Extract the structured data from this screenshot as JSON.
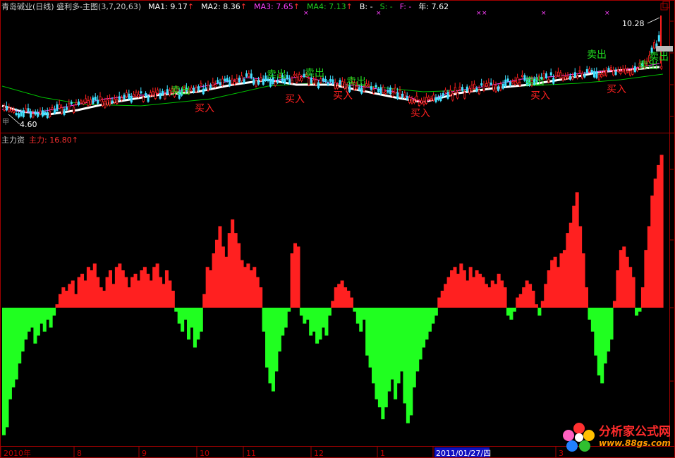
{
  "header": {
    "title": "青岛碱业(日线) 盛利多-主图(3,7,20,63)",
    "ma1": "MA1: 9.17",
    "ma2": "MA2: 8.36",
    "ma3": "MA3: 7.65",
    "ma4": "MA4: 7.13",
    "b": "B: -",
    "s": "S: -",
    "f": "F: -",
    "year": "年: 7.62",
    "arrow": "↑"
  },
  "sub_header": {
    "title": "主力资",
    "main_force": "主力: 16.80",
    "arrow": "↑"
  },
  "price_panel": {
    "high_label": "10.28",
    "low_label": "4.60",
    "bottom_left_label": "甲 ",
    "signals": [
      {
        "type": "sell",
        "label": "卖出"
      },
      {
        "type": "sell",
        "label": "卖出"
      },
      {
        "type": "sell",
        "label": "卖出"
      },
      {
        "type": "sell",
        "label": "卖出"
      },
      {
        "type": "sell",
        "label": "卖出"
      },
      {
        "type": "sell",
        "label": "卖出"
      },
      {
        "type": "sell",
        "label": "卖出"
      },
      {
        "type": "sell",
        "label": "卖出"
      },
      {
        "type": "buy",
        "label": "买入"
      },
      {
        "type": "buy",
        "label": "买入"
      },
      {
        "type": "buy",
        "label": "买入"
      },
      {
        "type": "buy",
        "label": "买入"
      },
      {
        "type": "buy",
        "label": "买入"
      },
      {
        "type": "buy",
        "label": "买入"
      }
    ]
  },
  "date_axis": {
    "labels": [
      "2010年",
      "8",
      "9",
      "10",
      "11",
      "12",
      "1",
      "2011/01/27/四",
      "3"
    ]
  },
  "logo": {
    "name": "分析家公式网",
    "url": "www.88gs.com"
  },
  "colors": {
    "up": "#ff2020",
    "down": "#20ff20",
    "ma_white": "#ffffff",
    "ma_green": "#00c000",
    "ma_magenta": "#ff40ff",
    "grid": "#a00000"
  },
  "chart_data": {
    "type": "bar",
    "title": "主力资",
    "series": [
      {
        "name": "主力",
        "values": [
          -160,
          -150,
          -115,
          -100,
          -90,
          -70,
          -55,
          -40,
          -30,
          -25,
          -45,
          -35,
          -20,
          -30,
          -15,
          -25,
          -10,
          5,
          20,
          30,
          25,
          35,
          40,
          20,
          45,
          50,
          40,
          60,
          55,
          65,
          45,
          30,
          25,
          45,
          55,
          35,
          60,
          65,
          55,
          45,
          30,
          45,
          50,
          40,
          55,
          60,
          50,
          40,
          60,
          65,
          45,
          35,
          55,
          40,
          25,
          -5,
          -20,
          -30,
          -15,
          -40,
          -25,
          -50,
          -40,
          -30,
          20,
          60,
          55,
          80,
          100,
          120,
          90,
          75,
          110,
          130,
          110,
          95,
          70,
          60,
          65,
          55,
          60,
          45,
          30,
          -30,
          -75,
          -95,
          -105,
          -80,
          -55,
          -35,
          -25,
          -5,
          80,
          95,
          90,
          -10,
          -20,
          -15,
          -35,
          -30,
          -45,
          -40,
          -25,
          -35,
          -10,
          10,
          30,
          35,
          40,
          30,
          25,
          15,
          -5,
          -20,
          -30,
          -15,
          -60,
          -75,
          -95,
          -115,
          -125,
          -140,
          -125,
          -105,
          -90,
          -115,
          -95,
          -80,
          -120,
          -145,
          -135,
          -100,
          -80,
          -65,
          -50,
          -40,
          -30,
          -20,
          -10,
          15,
          25,
          35,
          45,
          55,
          60,
          50,
          65,
          55,
          40,
          60,
          45,
          55,
          50,
          45,
          35,
          30,
          40,
          35,
          50,
          40,
          30,
          -10,
          -15,
          -5,
          15,
          20,
          30,
          40,
          35,
          25,
          5,
          -10,
          10,
          35,
          55,
          70,
          75,
          60,
          80,
          85,
          110,
          125,
          150,
          170,
          120,
          80,
          30,
          -15,
          -30,
          -60,
          -85,
          -95,
          -70,
          -55,
          -40,
          10,
          55,
          85,
          90,
          75,
          60,
          45,
          -10,
          -5,
          30,
          85,
          120,
          165,
          190,
          210,
          225
        ]
      }
    ],
    "ylim": [
      -170,
      240
    ]
  }
}
